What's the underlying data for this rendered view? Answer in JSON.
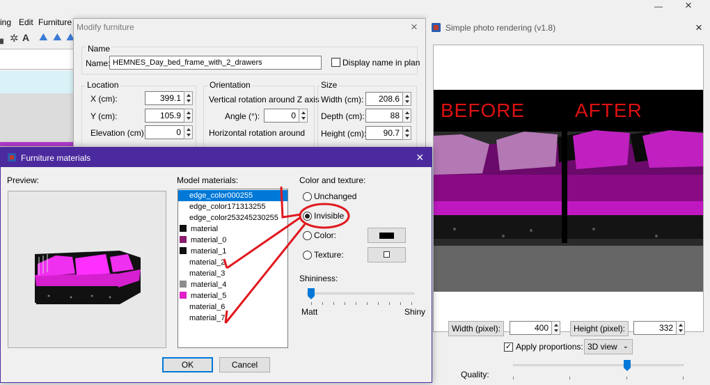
{
  "menubar": {
    "items": [
      "ing",
      "Edit",
      "Furniture"
    ]
  },
  "main_window": {
    "close_glyph": "×",
    "minimize_glyph": "—"
  },
  "modify_dialog": {
    "title": "Modify furniture",
    "name_group": "Name",
    "name_label": "Name:",
    "name_value": "HEMNES_Day_bed_frame_with_2_drawers",
    "display_name_label": "Display name in plan",
    "location_group": "Location",
    "x_label": "X (cm):",
    "x_value": "399.1",
    "y_label": "Y (cm):",
    "y_value": "105.9",
    "elevation_label": "Elevation (cm):",
    "elevation_value": "0",
    "orientation_group": "Orientation",
    "vertical_rotation_label": "Vertical rotation around Z axis",
    "angle_label": "Angle (°):",
    "angle_value": "0",
    "horizontal_rotation_label": "Horizontal rotation around",
    "size_group": "Size",
    "width_label": "Width (cm):",
    "width_value": "208.6",
    "depth_label": "Depth (cm):",
    "depth_value": "88",
    "height_label": "Height (cm):",
    "height_value": "90.7"
  },
  "materials_dialog": {
    "title": "Furniture materials",
    "preview_label": "Preview:",
    "model_materials_label": "Model materials:",
    "materials": [
      {
        "name": "edge_color000255",
        "swatch": null,
        "selected": true
      },
      {
        "name": "edge_color171313255",
        "swatch": null,
        "selected": false
      },
      {
        "name": "edge_color253245230255",
        "swatch": null,
        "selected": false
      },
      {
        "name": "material",
        "swatch": "#111111",
        "selected": false
      },
      {
        "name": "material_0",
        "swatch": "#8a1d6e",
        "selected": false
      },
      {
        "name": "material_1",
        "swatch": "#111111",
        "selected": false
      },
      {
        "name": "material_2",
        "swatch": null,
        "selected": false
      },
      {
        "name": "material_3",
        "swatch": null,
        "selected": false
      },
      {
        "name": "material_4",
        "swatch": "#8c8c8c",
        "selected": false
      },
      {
        "name": "material_5",
        "swatch": "#e020c8",
        "selected": false
      },
      {
        "name": "material_6",
        "swatch": null,
        "selected": false
      },
      {
        "name": "material_7",
        "swatch": null,
        "selected": false
      }
    ],
    "color_texture_label": "Color and texture:",
    "unchanged_label": "Unchanged",
    "invisible_label": "Invisible",
    "color_label": "Color:",
    "texture_label": "Texture:",
    "selected_option": "Invisible",
    "color_value": "#000000",
    "shininess_label": "Shininess:",
    "shininess_level": 0,
    "matt_label": "Matt",
    "shiny_label": "Shiny",
    "ok_label": "OK",
    "cancel_label": "Cancel",
    "close_glyph": "×"
  },
  "render_dialog": {
    "title": "Simple photo rendering (v1.8)",
    "before_label": "BEFORE",
    "after_label": "AFTER",
    "width_label": "Width (pixel):",
    "width_value": "400",
    "height_label": "Height (pixel):",
    "height_value": "332",
    "apply_proportions_label": "Apply proportions:",
    "apply_proportions_checked": true,
    "view_select_value": "3D view",
    "quality_label": "Quality:",
    "quality_ticks": [
      "1",
      "2",
      "3",
      "4"
    ],
    "quality_level": 3,
    "close_glyph": "×"
  },
  "colors": {
    "accent": "#0078d7",
    "title_bar": "#4b2a9e",
    "annotation": "#e0181e",
    "sofa": "#e020c8"
  }
}
